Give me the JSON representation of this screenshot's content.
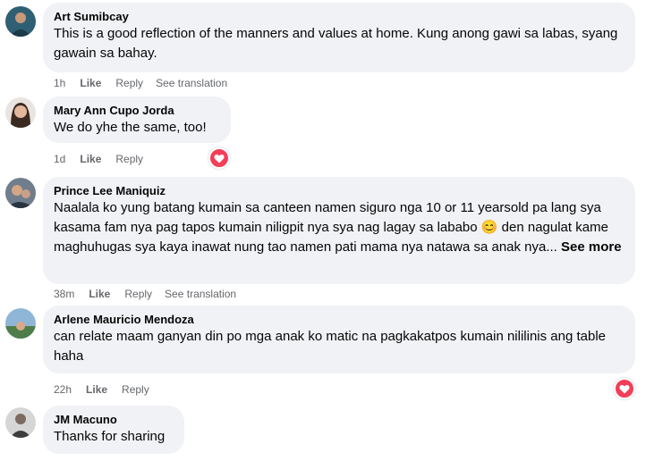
{
  "comments": [
    {
      "name": "Art Sumibcay",
      "text": "This is a good reflection of the manners and values at home. Kung anong gawi sa labas, syang gawain sa bahay.",
      "time": "1h",
      "like": "Like",
      "reply": "Reply",
      "translate": "See translation"
    },
    {
      "name": "Mary Ann Cupo Jorda",
      "text": "We do yhe the same, too!",
      "time": "1d",
      "like": "Like",
      "reply": "Reply",
      "reaction": "love-reaction-icon"
    },
    {
      "name": "Prince Lee Maniquiz",
      "text": "Naalala ko yung batang kumain sa canteen namen siguro nga 10 or 11 yearsold pa lang sya kasama fam nya pag tapos kumain niligpit nya sya nag lagay sa lababo",
      "emoji": "😊",
      "text2": " den nagulat kame maghuhugas sya kaya inawat nung tao namen pati mama nya natawa sa anak nya...",
      "see_more": "See more",
      "time": "38m",
      "like": "Like",
      "reply": "Reply",
      "translate": "See translation"
    },
    {
      "name": "Arlene Mauricio Mendoza",
      "text": "can relate maam ganyan din po mga anak ko matic na pagkakatpos kumain nililinis ang table haha",
      "time": "22h",
      "like": "Like",
      "reply": "Reply",
      "reaction": "love-reaction-icon"
    },
    {
      "name": "JM Macuno",
      "text": "Thanks for sharing"
    }
  ],
  "colors": {
    "bubble": "#f0f2f5",
    "meta": "#65676b",
    "love": "#f33e58"
  }
}
